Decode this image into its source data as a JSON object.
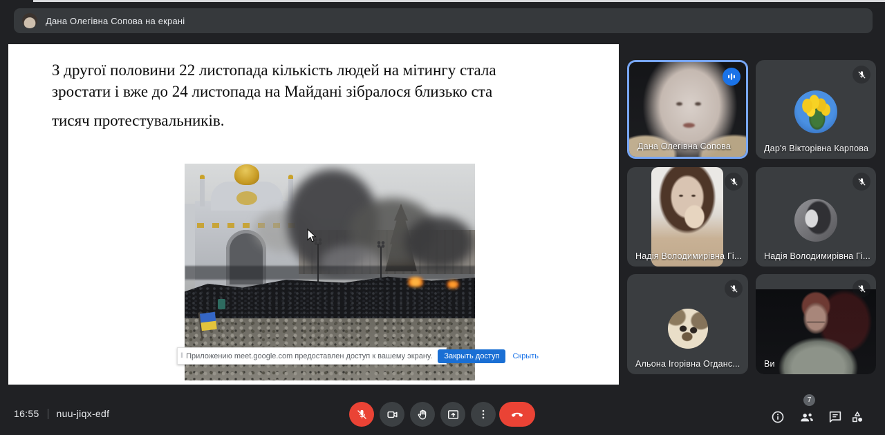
{
  "banner": {
    "text": "Дана Олегівна Сопова на екрані"
  },
  "slide": {
    "lines": [
      "З другої половини 22 листопада кількість людей на мітингу стала",
      "зростати і вже до 24 листопада на Майдані зібралося близько ста",
      "тисяч протестувальників."
    ]
  },
  "share_notification": {
    "grip": "‖",
    "message": "Приложению meet.google.com предоставлен доступ к вашему экрану.",
    "close_button": "Закрыть доступ",
    "hide_link": "Скрыть"
  },
  "participants": [
    {
      "name": "Дана Олегівна Сопова",
      "speaking": true,
      "video": true
    },
    {
      "name": "Дар'я Вікторівна Карпова",
      "muted": true,
      "avatar": "yellow-tulips"
    },
    {
      "name": "Надія Володимирівна Гі...",
      "muted": true,
      "video": true
    },
    {
      "name": "Надія Володимирівна Гі...",
      "muted": true,
      "avatar": "bw-portrait"
    },
    {
      "name": "Альона Ігорівна Огданс...",
      "muted": true,
      "avatar": "puppy"
    },
    {
      "name": "Ви",
      "muted": true,
      "video": true
    }
  ],
  "bottom_bar": {
    "time": "16:55",
    "meeting_code": "nuu-jiqx-edf"
  },
  "right_panel": {
    "participants_badge": "7"
  },
  "icons": [
    "mic-off-icon",
    "speaker-indicator-icon",
    "camera-icon",
    "raise-hand-icon",
    "present-screen-icon",
    "more-options-icon",
    "end-call-icon",
    "info-icon",
    "people-icon",
    "chat-icon",
    "activities-icon",
    "mouse-cursor"
  ],
  "colors": {
    "background": "#202124",
    "tile": "#3a3d40",
    "speaking_border": "#78a7f6",
    "speaker_chip": "#1a73e8",
    "danger_red": "#ea4335",
    "share_button_blue": "#1a6fd4",
    "text_light": "#e8eaed"
  }
}
